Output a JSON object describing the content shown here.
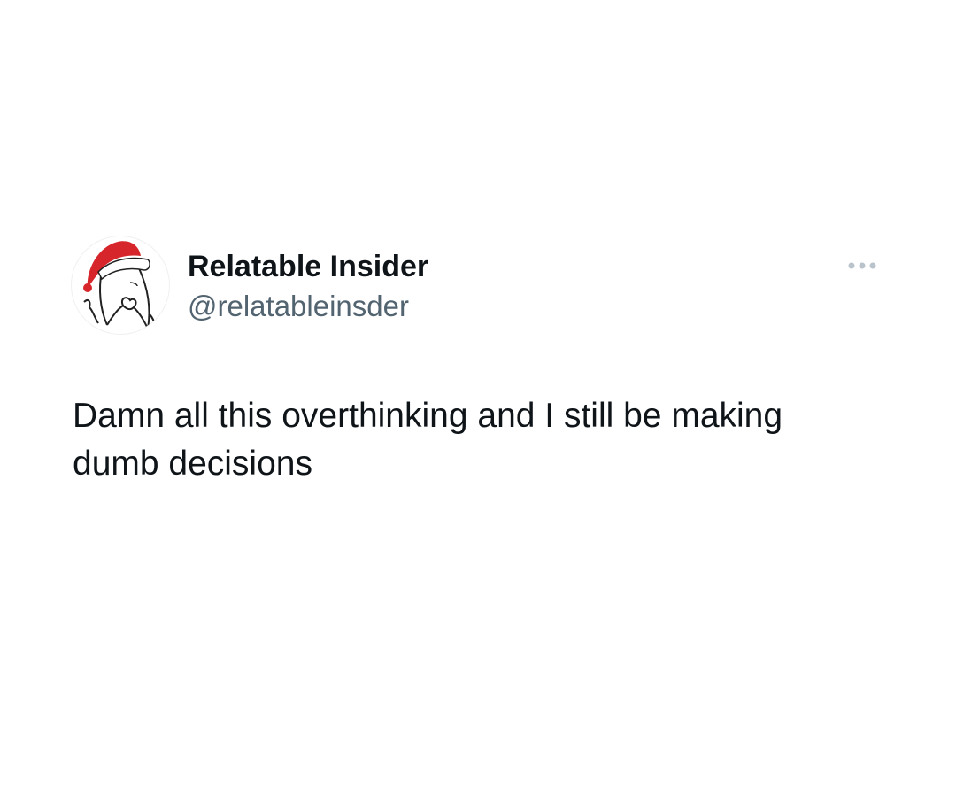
{
  "tweet": {
    "display_name": "Relatable Insider",
    "handle": "@relatableinsder",
    "text": "Damn all this overthinking and I still be making dumb decisions",
    "more_icon": "more-horizontal-icon",
    "avatar_icon": "santa-hat-character-avatar"
  },
  "colors": {
    "background": "#ffffff",
    "name": "#0f1419",
    "handle": "#536471",
    "more_dots": "#b9c3cc",
    "hat_red": "#d7262b"
  }
}
